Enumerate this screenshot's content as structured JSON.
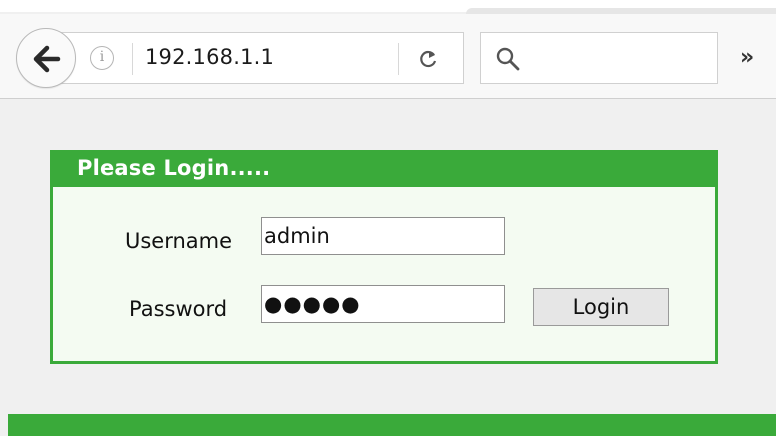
{
  "browser": {
    "url": "192.168.1.1",
    "info_glyph": "i",
    "overflow_glyph": "»",
    "icons": [
      "back-arrow-icon",
      "info-icon",
      "reload-icon",
      "search-icon",
      "overflow-chevron-icon"
    ]
  },
  "login": {
    "title": "Please Login.....",
    "username_label": "Username",
    "username_value": "admin",
    "password_label": "Password",
    "password_mask": "●●●●●",
    "button_label": "Login"
  },
  "colors": {
    "accent_green": "#3aaa3a",
    "background": "#f0f0f0",
    "panel_background": "#f4fbf2"
  }
}
